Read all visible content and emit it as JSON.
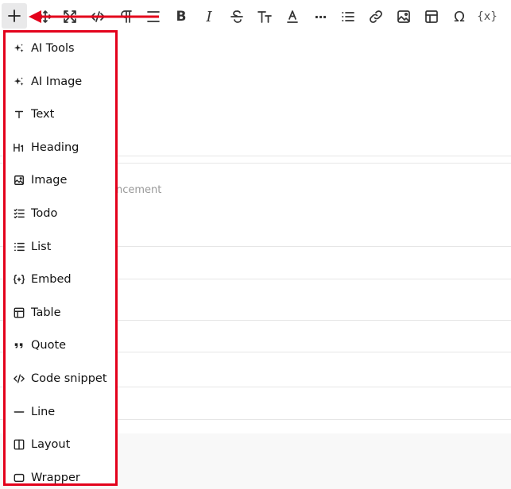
{
  "toolbar": {
    "buttons": [
      {
        "name": "add",
        "icon": "plus-icon"
      },
      {
        "name": "drag",
        "icon": "drag-move-icon"
      },
      {
        "name": "fullscreen",
        "icon": "fullscreen-icon"
      },
      {
        "name": "code",
        "icon": "code-icon"
      },
      {
        "name": "paragraph",
        "icon": "pilcrow-icon"
      },
      {
        "name": "align",
        "icon": "align-icon"
      },
      {
        "name": "bold",
        "icon": "bold-icon",
        "glyph": "B"
      },
      {
        "name": "italic",
        "icon": "italic-icon",
        "glyph": "I"
      },
      {
        "name": "strikethrough",
        "icon": "strikethrough-icon"
      },
      {
        "name": "font-size",
        "icon": "text-size-icon"
      },
      {
        "name": "font-color",
        "icon": "font-color-icon"
      },
      {
        "name": "more",
        "icon": "more-icon",
        "glyph": "···"
      },
      {
        "name": "list",
        "icon": "list-icon"
      },
      {
        "name": "link",
        "icon": "link-icon"
      },
      {
        "name": "image",
        "icon": "image-icon"
      },
      {
        "name": "table",
        "icon": "table-icon"
      },
      {
        "name": "special-char",
        "icon": "omega-icon",
        "glyph": "Ω"
      },
      {
        "name": "variable",
        "icon": "variable-icon",
        "glyph": "{x}"
      }
    ]
  },
  "editor": {
    "placeholder_fragment": "ncement"
  },
  "menu": {
    "items": [
      {
        "label": "AI Tools",
        "icon": "sparkle-icon"
      },
      {
        "label": "AI Image",
        "icon": "sparkle-icon"
      },
      {
        "label": "Text",
        "icon": "text-t-icon"
      },
      {
        "label": "Heading",
        "icon": "heading-h1-icon"
      },
      {
        "label": "Image",
        "icon": "image-icon"
      },
      {
        "label": "Todo",
        "icon": "todo-list-icon"
      },
      {
        "label": "List",
        "icon": "bullet-list-icon"
      },
      {
        "label": "Embed",
        "icon": "embed-icon"
      },
      {
        "label": "Table",
        "icon": "table-icon"
      },
      {
        "label": "Quote",
        "icon": "quote-icon"
      },
      {
        "label": "Code snippet",
        "icon": "code-icon"
      },
      {
        "label": "Line",
        "icon": "line-icon"
      },
      {
        "label": "Layout",
        "icon": "layout-icon"
      },
      {
        "label": "Wrapper",
        "icon": "wrapper-icon"
      }
    ]
  },
  "colors": {
    "highlight": "#e3001b",
    "active_button_bg": "#e9e9ea",
    "divider": "#e6e6e6"
  }
}
